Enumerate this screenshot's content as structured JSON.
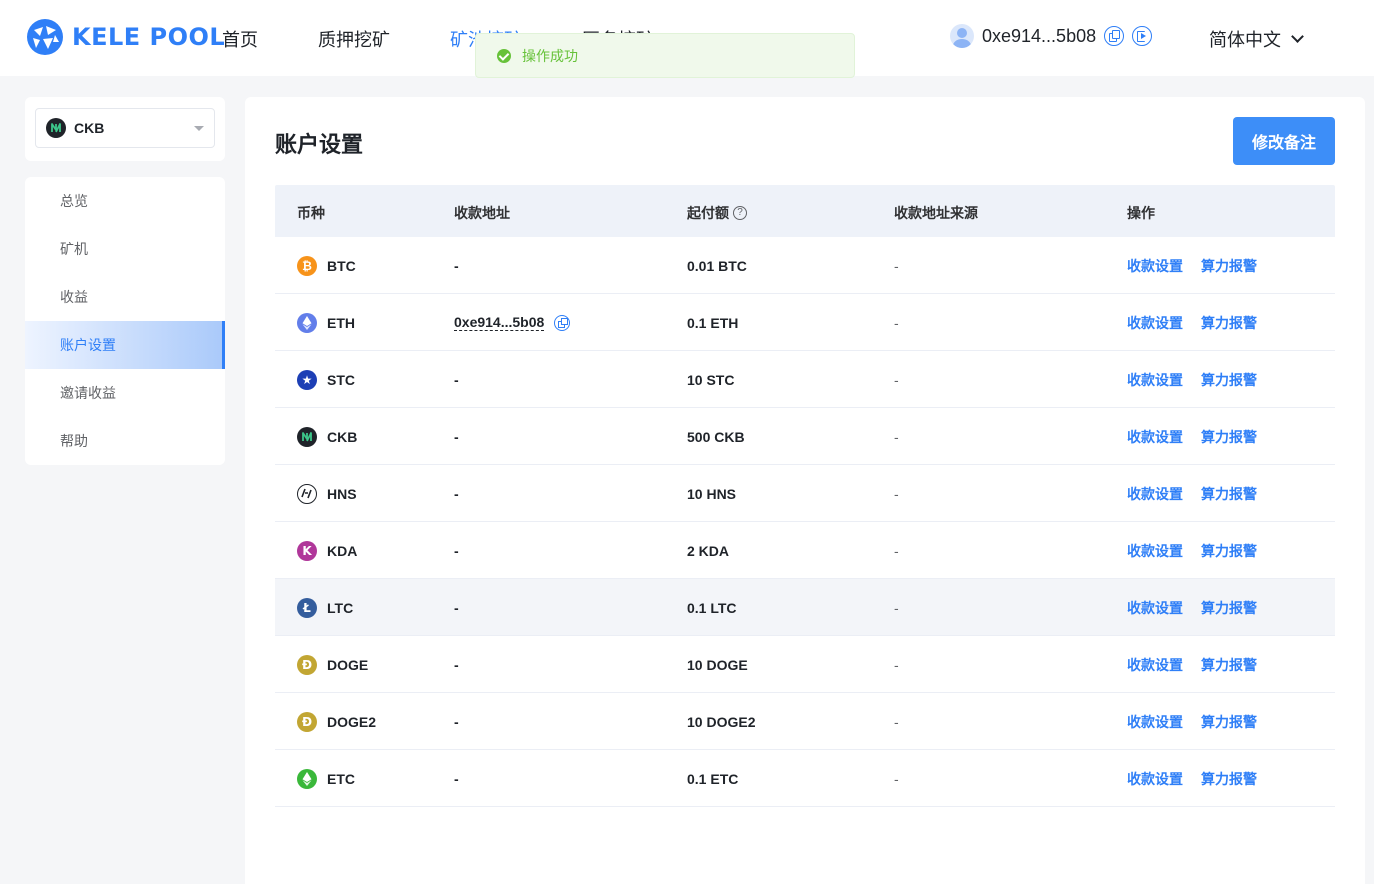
{
  "brand": {
    "name": "KELE POOL",
    "accent": "#2f7ff7"
  },
  "nav": {
    "items": [
      {
        "label": "首页",
        "active": false
      },
      {
        "label": "质押挖矿",
        "active": false
      },
      {
        "label": "矿池挖矿",
        "active": true
      },
      {
        "label": "匿名挖矿",
        "active": false
      }
    ]
  },
  "account": {
    "address": "0xe914...5b08"
  },
  "language": {
    "label": "简体中文"
  },
  "toast": {
    "message": "操作成功",
    "type": "success",
    "color": "#67c23a"
  },
  "coin_selector": {
    "value": "CKB"
  },
  "sidebar": {
    "items": [
      {
        "label": "总览",
        "active": false
      },
      {
        "label": "矿机",
        "active": false
      },
      {
        "label": "收益",
        "active": false
      },
      {
        "label": "账户设置",
        "active": true
      },
      {
        "label": "邀请收益",
        "active": false
      },
      {
        "label": "帮助",
        "active": false
      }
    ]
  },
  "page": {
    "title": "账户设置",
    "remark_button": "修改备注"
  },
  "table": {
    "headers": {
      "coin": "币种",
      "address": "收款地址",
      "min_payout": "起付额",
      "address_source": "收款地址来源",
      "actions": "操作"
    },
    "action_labels": {
      "payout_settings": "收款设置",
      "hashrate_alert": "算力报警"
    },
    "rows": [
      {
        "coin": "BTC",
        "icon": "bitcoin-icon",
        "color": "#f7931a",
        "address": "-",
        "min_payout": "0.01 BTC",
        "source": "-"
      },
      {
        "coin": "ETH",
        "icon": "ethereum-icon",
        "color": "#627eea",
        "address": "0xe914...5b08",
        "min_payout": "0.1 ETH",
        "source": "-"
      },
      {
        "coin": "STC",
        "icon": "starcoin-icon",
        "color": "#1d3fb5",
        "address": "-",
        "min_payout": "10 STC",
        "source": "-"
      },
      {
        "coin": "CKB",
        "icon": "nervos-icon",
        "color": "#1f2329",
        "address": "-",
        "min_payout": "500 CKB",
        "source": "-"
      },
      {
        "coin": "HNS",
        "icon": "handshake-icon",
        "color": "#ffffff",
        "address": "-",
        "min_payout": "10 HNS",
        "source": "-"
      },
      {
        "coin": "KDA",
        "icon": "kadena-icon",
        "color": "#b0379a",
        "address": "-",
        "min_payout": "2 KDA",
        "source": "-"
      },
      {
        "coin": "LTC",
        "icon": "litecoin-icon",
        "color": "#345d9d",
        "address": "-",
        "min_payout": "0.1 LTC",
        "source": "-"
      },
      {
        "coin": "DOGE",
        "icon": "dogecoin-icon",
        "color": "#c2a633",
        "address": "-",
        "min_payout": "10 DOGE",
        "source": "-"
      },
      {
        "coin": "DOGE2",
        "icon": "dogecoin-icon",
        "color": "#c2a633",
        "address": "-",
        "min_payout": "10 DOGE2",
        "source": "-"
      },
      {
        "coin": "ETC",
        "icon": "ethereum-classic-icon",
        "color": "#3ab83a",
        "address": "-",
        "min_payout": "0.1 ETC",
        "source": "-"
      }
    ]
  }
}
